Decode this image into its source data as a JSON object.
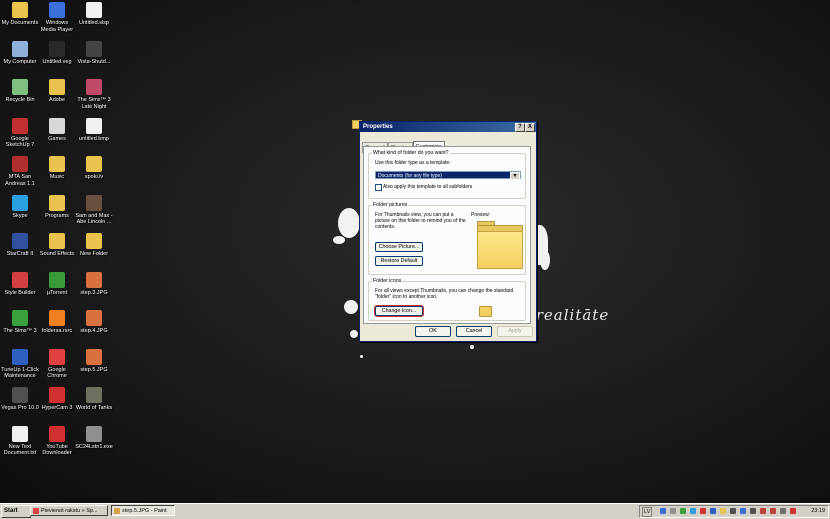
{
  "desktop": {
    "wallpaper_text": "ta realitāte",
    "icons": [
      {
        "label": "My Documents",
        "color": "#e8c44e"
      },
      {
        "label": "Windows Media Player",
        "color": "#3a6fd8"
      },
      {
        "label": "Untitled.slsp",
        "color": "#f0f0f0"
      },
      {
        "label": "My Computer",
        "color": "#8fb0d8"
      },
      {
        "label": "Untitled.veg",
        "color": "#2a2a2a"
      },
      {
        "label": "Vista-Shutd...",
        "color": "#444444"
      },
      {
        "label": "Recycle Bin",
        "color": "#7fbf7f"
      },
      {
        "label": "Adobe",
        "color": "#e8c44e"
      },
      {
        "label": "The Sims™ 3 Late Night",
        "color": "#c04a6a"
      },
      {
        "label": "Google SketchUp 7",
        "color": "#c03030"
      },
      {
        "label": "Games",
        "color": "#d8d8d8"
      },
      {
        "label": "untitled.bmp",
        "color": "#f0f0f0"
      },
      {
        "label": "MTA San Andreas 1.1",
        "color": "#b03030"
      },
      {
        "label": "Music",
        "color": "#e8c44e"
      },
      {
        "label": "spoki.lv",
        "color": "#e8c44e"
      },
      {
        "label": "Skype",
        "color": "#2aa0e0"
      },
      {
        "label": "Programs",
        "color": "#e8c44e"
      },
      {
        "label": "Sam and Max - Abe Lincoln ...",
        "color": "#6a5040"
      },
      {
        "label": "StarCraft II",
        "color": "#3050a0"
      },
      {
        "label": "Sound Effects",
        "color": "#e8c44e"
      },
      {
        "label": "New Folder",
        "color": "#e8c44e"
      },
      {
        "label": "Style Builder",
        "color": "#d04040"
      },
      {
        "label": "µTorrent",
        "color": "#3a9a3a"
      },
      {
        "label": "step.3.JPG",
        "color": "#d87040"
      },
      {
        "label": "The Sims™ 3",
        "color": "#3aa03a"
      },
      {
        "label": "foldersa.rsrc",
        "color": "#f08020"
      },
      {
        "label": "step.4.JPG",
        "color": "#d87040"
      },
      {
        "label": "TuneUp 1-Click Maintenance",
        "color": "#3060c0"
      },
      {
        "label": "Google Chrome",
        "color": "#e04040"
      },
      {
        "label": "step.5.JPG",
        "color": "#d87040"
      },
      {
        "label": "Vegas Pro 10.0",
        "color": "#505050"
      },
      {
        "label": "HyperCam 3",
        "color": "#d03030"
      },
      {
        "label": "World of Tanks",
        "color": "#707060"
      },
      {
        "label": "New Text Document.txt",
        "color": "#f0f0f0"
      },
      {
        "label": "YouTube Downloader",
        "color": "#d03030"
      },
      {
        "label": "SC24Lstn1.exe",
        "color": "#909090"
      }
    ]
  },
  "dialog": {
    "title": "Properties",
    "help_btn": "?",
    "close_btn": "X",
    "tabs": [
      "General",
      "Sharing",
      "Customize"
    ],
    "q_label": "What kind of folder do you want?",
    "template_label": "Use this folder type as a template:",
    "template_value": "Documents (for any file type)",
    "subfolders_check": "Also apply this template to all subfolders",
    "pictures_group": "Folder pictures",
    "pictures_text": "For Thumbnails view, you can put a picture on this folder to remind you of the contents.",
    "preview_label": "Preview:",
    "choose_picture": "Choose Picture...",
    "restore_default": "Restore Default",
    "icons_group": "Folder icons",
    "icons_text": "For all views except Thumbnails, you can change the standard \"folder\" icon to another icon.",
    "change_icon": "Change Icon...",
    "ok": "OK",
    "cancel": "Cancel",
    "apply": "Apply"
  },
  "taskbar": {
    "start": "Start",
    "tasks": [
      {
        "label": "Pievienot rakstu » Sp...",
        "color": "#e04040"
      },
      {
        "label": "step.5.JPG - Paint",
        "color": "#d8a040"
      }
    ],
    "language": "LV",
    "clock": "23:19"
  }
}
